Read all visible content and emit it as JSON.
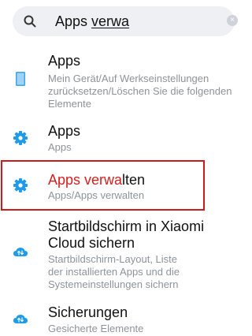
{
  "search": {
    "typed_prefix": "Apps ",
    "typed_underlined": "verwa",
    "search_icon": "search-icon",
    "clear_icon": "clear-icon"
  },
  "results": [
    {
      "title": "Apps",
      "subtitle_lines": [
        "Mein Gerät/Auf Werkseinstellungen",
        "zurücksetzen/Löschen Sie die folgenden",
        "Elemente"
      ],
      "icon": "phone-icon"
    },
    {
      "title": "Apps",
      "subtitle_lines": [
        "Apps"
      ],
      "icon": "gear-icon"
    },
    {
      "title_highlight": "Apps verwa",
      "title_rest": "lten",
      "subtitle_lines": [
        "Apps/Apps verwalten"
      ],
      "icon": "gear-icon"
    },
    {
      "title_lines": [
        "Startbildschirm in Xiaomi",
        "Cloud sichern"
      ],
      "subtitle_lines": [
        "Startbildschirm-Layout, Liste",
        "der installierten Apps und die",
        "Systemeinstellungen sichern"
      ],
      "icon": "cloud-icon"
    },
    {
      "title": "Sicherungen",
      "subtitle_lines": [
        "Gesicherte Elemente"
      ],
      "icon": "cloud-icon"
    }
  ],
  "colors": {
    "accent_icon": "#1e9be9",
    "highlight_text": "#d41f1f",
    "selection_border": "#cc1b1b"
  }
}
